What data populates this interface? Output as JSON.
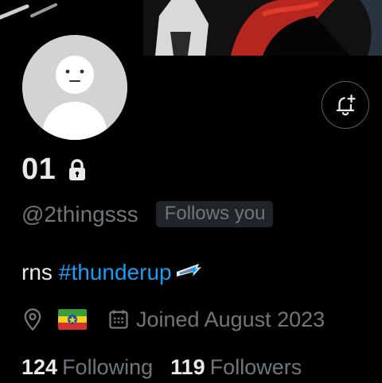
{
  "profile": {
    "display_name": "01",
    "handle": "@2thingsss",
    "follows_you": "Follows you",
    "bio_text": "rns",
    "bio_hashtag": "#thunderup",
    "joined": "Joined August 2023"
  },
  "stats": {
    "following_count": "124",
    "following_label": "Following",
    "followers_count": "119",
    "followers_label": "Followers"
  },
  "icons": {
    "lock": "lock-icon",
    "location": "location-pin-icon",
    "calendar": "calendar-icon",
    "notify": "bell-plus-icon",
    "flag": "ethiopia-flag",
    "team_logo": "okc-thunder-logo"
  },
  "colors": {
    "background": "#000000",
    "text_primary": "#e7e9ea",
    "text_secondary": "#71767b",
    "link": "#1d9bf0",
    "badge_bg": "#202327"
  }
}
